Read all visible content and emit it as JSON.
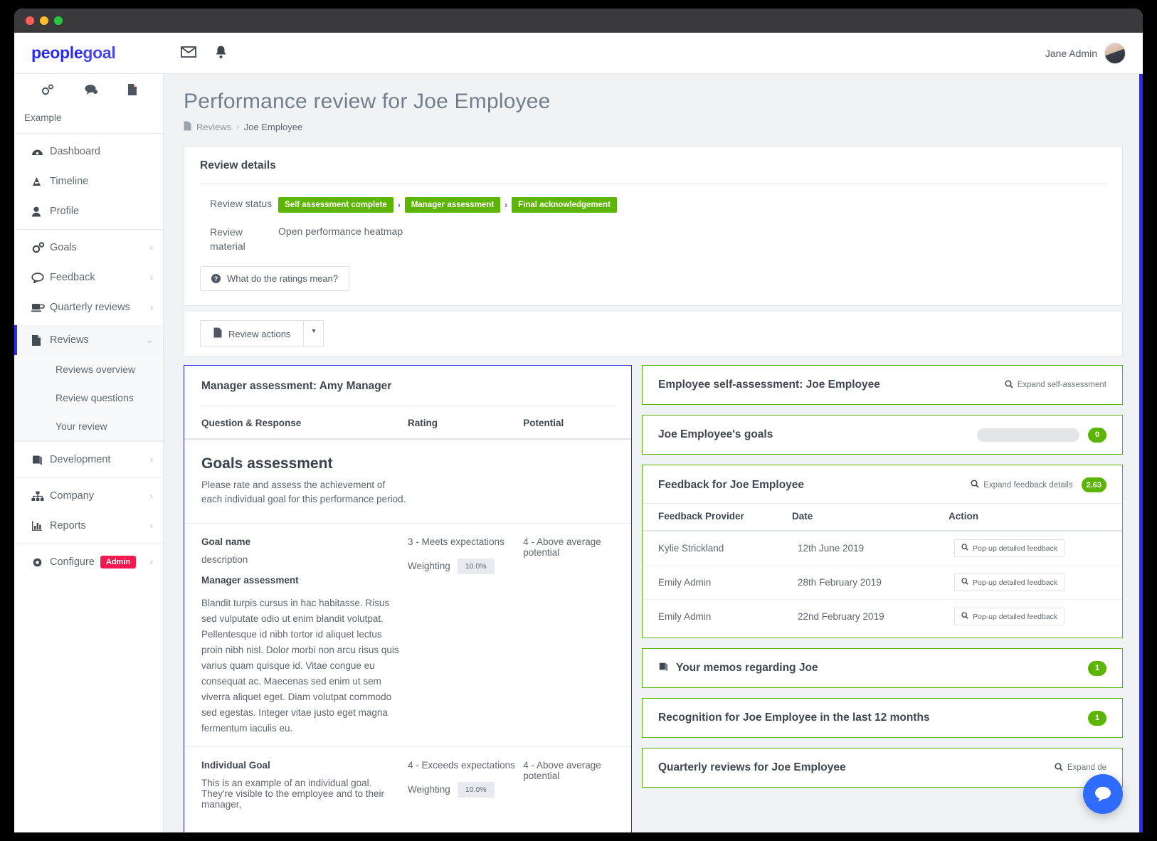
{
  "window": {
    "dots": [
      "close",
      "minimize",
      "maximize"
    ]
  },
  "topbar": {
    "logo_part1": "people",
    "logo_part2": "goal",
    "icons": [
      {
        "name": "mail-icon",
        "glyph": "✉"
      },
      {
        "name": "bell-icon",
        "glyph": "🔔"
      }
    ],
    "user_name": "Jane Admin"
  },
  "sidebar": {
    "top_icons": [
      {
        "name": "settings-gears-icon",
        "glyph": "⚙"
      },
      {
        "name": "chat-bubbles-icon",
        "glyph": "💬"
      },
      {
        "name": "document-icon",
        "glyph": "📄"
      }
    ],
    "org_label": "Example",
    "group1": [
      {
        "label": "Dashboard",
        "icon": "dashboard-icon",
        "glyph": "◔",
        "chevron": ""
      },
      {
        "label": "Timeline",
        "icon": "timeline-icon",
        "glyph": "A",
        "chevron": ""
      },
      {
        "label": "Profile",
        "icon": "profile-icon",
        "glyph": "👤",
        "chevron": ""
      }
    ],
    "group2": [
      {
        "label": "Goals",
        "icon": "goals-gears-icon",
        "glyph": "⚙",
        "chevron": "›"
      },
      {
        "label": "Feedback",
        "icon": "feedback-bubble-icon",
        "glyph": "🗩",
        "chevron": "›"
      },
      {
        "label": "Quarterly reviews",
        "icon": "coffee-cup-icon",
        "glyph": "☕",
        "chevron": "›"
      }
    ],
    "reviews": {
      "label": "Reviews",
      "icon": "reviews-document-icon",
      "glyph": "📄",
      "chevron": "⌄"
    },
    "reviews_sub": [
      {
        "label": "Reviews overview"
      },
      {
        "label": "Review questions"
      },
      {
        "label": "Your review"
      }
    ],
    "group3": [
      {
        "label": "Development",
        "icon": "book-icon",
        "glyph": "📕",
        "chevron": "›"
      }
    ],
    "group4": [
      {
        "label": "Company",
        "icon": "org-chart-icon",
        "glyph": "⚙",
        "chevron": "›"
      },
      {
        "label": "Reports",
        "icon": "bar-chart-icon",
        "glyph": "📊",
        "chevron": "›"
      }
    ],
    "configure": {
      "label": "Configure",
      "icon": "gear-icon",
      "glyph": "⚙",
      "badge": "Admin",
      "chevron": "›"
    }
  },
  "page": {
    "title": "Performance review for Joe Employee",
    "breadcrumb_icon": "document-icon",
    "breadcrumb_root": "Reviews",
    "breadcrumb_sep": "›",
    "breadcrumb_current": "Joe Employee"
  },
  "review_details": {
    "heading": "Review details",
    "status_label": "Review status",
    "status_steps": [
      "Self assessment complete",
      "Manager assessment",
      "Final acknowledgement"
    ],
    "step_separator": "›",
    "material_label": "Review material",
    "material_value": "Open performance heatmap",
    "ratings_button": "What do the ratings mean?",
    "ratings_icon": "question-mark-icon"
  },
  "action_bar": {
    "review_actions_label": "Review actions",
    "review_actions_icon": "document-icon",
    "caret": "▾"
  },
  "manager_panel": {
    "heading": "Manager assessment: Amy Manager",
    "columns": [
      "Question & Response",
      "Rating",
      "Potential"
    ],
    "section": {
      "title": "Goals assessment",
      "description": "Please rate and assess the achievement of each individual goal for this performance period."
    },
    "rows": [
      {
        "goal_name": "Goal name",
        "goal_description": "description",
        "assessment_label": "Manager assessment",
        "assessment_text": "Blandit turpis cursus in hac habitasse. Risus sed vulputate odio ut enim blandit volutpat. Pellentesque id nibh tortor id aliquet lectus proin nibh nisl. Dolor morbi non arcu risus quis varius quam quisque id. Vitae congue eu consequat ac. Maecenas sed enim ut sem viverra aliquet eget. Diam volutpat commodo sed egestas. Integer vitae justo eget magna fermentum iaculis eu.",
        "rating": "3 - Meets expectations",
        "weighting_label": "Weighting",
        "weighting_value": "10.0%",
        "potential": "4 - Above average potential"
      },
      {
        "goal_name": "Individual Goal",
        "goal_description": "This is an example of an individual goal. They're visible to the employee and to their manager,",
        "assessment_label": "",
        "assessment_text": "",
        "rating": "4 - Exceeds expectations",
        "weighting_label": "Weighting",
        "weighting_value": "10.0%",
        "potential": "4 - Above average potential"
      }
    ]
  },
  "right_panels": {
    "self_assessment": {
      "title": "Employee self-assessment: Joe Employee",
      "expand_label": "Expand self-assessment",
      "expand_icon": "magnifier-icon"
    },
    "goals": {
      "title": "Joe Employee's goals",
      "badge": "0",
      "has_skeleton": true
    },
    "feedback": {
      "title": "Feedback for Joe Employee",
      "expand_label": "Expand feedback details",
      "expand_icon": "magnifier-icon",
      "badge": "2.63",
      "columns": [
        "Feedback Provider",
        "Date",
        "Action"
      ],
      "rows": [
        {
          "provider": "Kylie Strickland",
          "date": "12th June 2019",
          "action": "Pop-up detailed feedback"
        },
        {
          "provider": "Emily Admin",
          "date": "28th February 2019",
          "action": "Pop-up detailed feedback"
        },
        {
          "provider": "Emily Admin",
          "date": "22nd February 2019",
          "action": "Pop-up detailed feedback"
        }
      ]
    },
    "memos": {
      "title": "Your memos regarding Joe",
      "icon": "book-icon",
      "badge": "1"
    },
    "recognition": {
      "title": "Recognition for Joe Employee in the last 12 months",
      "badge": "1"
    },
    "quarterly": {
      "title": "Quarterly reviews for Joe Employee",
      "expand_label": "Expand de",
      "expand_icon": "magnifier-icon"
    }
  },
  "chat": {
    "icon": "chat-bubble-icon"
  },
  "colors": {
    "brand_blue": "#2a2af5",
    "green": "#5cb500",
    "admin_red": "#f5194f",
    "chat_blue": "#2f6bff"
  }
}
